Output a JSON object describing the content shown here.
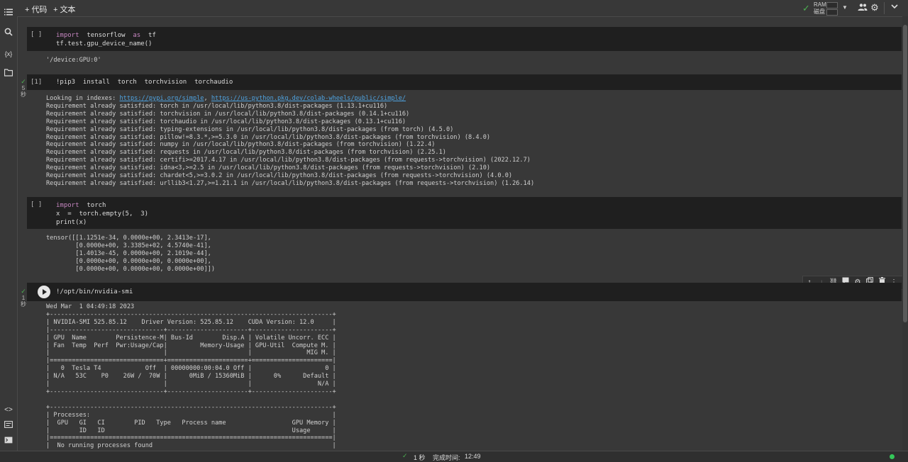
{
  "toolbar": {
    "add_code": "代码",
    "add_text": "文本",
    "ram_label": "RAM",
    "disk_label": "磁盘"
  },
  "cells": [
    {
      "exec_label": "[ ]",
      "code_lines": [
        {
          "kw1": "import",
          "t1": "  tensorflow  ",
          "kw2": "as",
          "t2": "  tf"
        },
        {
          "text": "tf.test.gpu_device_name()"
        }
      ],
      "output": "'/device:GPU:0'"
    },
    {
      "exec_label": "[1]",
      "status_time": "5",
      "status_unit": "秒",
      "code": "!pip3  install  torch  torchvision  torchaudio",
      "output_prefix": "Looking in indexes: ",
      "link1": "https://pypi.org/simple",
      "link_sep": ", ",
      "link2": "https://us-python.pkg.dev/colab-wheels/public/simple/",
      "output_lines": [
        "Requirement already satisfied: torch in /usr/local/lib/python3.8/dist-packages (1.13.1+cu116)",
        "Requirement already satisfied: torchvision in /usr/local/lib/python3.8/dist-packages (0.14.1+cu116)",
        "Requirement already satisfied: torchaudio in /usr/local/lib/python3.8/dist-packages (0.13.1+cu116)",
        "Requirement already satisfied: typing-extensions in /usr/local/lib/python3.8/dist-packages (from torch) (4.5.0)",
        "Requirement already satisfied: pillow!=8.3.*,>=5.3.0 in /usr/local/lib/python3.8/dist-packages (from torchvision) (8.4.0)",
        "Requirement already satisfied: numpy in /usr/local/lib/python3.8/dist-packages (from torchvision) (1.22.4)",
        "Requirement already satisfied: requests in /usr/local/lib/python3.8/dist-packages (from torchvision) (2.25.1)",
        "Requirement already satisfied: certifi>=2017.4.17 in /usr/local/lib/python3.8/dist-packages (from requests->torchvision) (2022.12.7)",
        "Requirement already satisfied: idna<3,>=2.5 in /usr/local/lib/python3.8/dist-packages (from requests->torchvision) (2.10)",
        "Requirement already satisfied: chardet<5,>=3.0.2 in /usr/local/lib/python3.8/dist-packages (from requests->torchvision) (4.0.0)",
        "Requirement already satisfied: urllib3<1.27,>=1.21.1 in /usr/local/lib/python3.8/dist-packages (from requests->torchvision) (1.26.14)"
      ]
    },
    {
      "exec_label": "[ ]",
      "code_lines": [
        {
          "kw1": "import",
          "t1": "  torch"
        },
        {
          "text": "x  =  torch.empty(5,  3)"
        },
        {
          "text": "print(x)"
        }
      ],
      "output_lines": [
        "tensor([[1.1251e-34, 0.0000e+00, 2.3413e-17],",
        "        [0.0000e+00, 3.3385e+02, 4.5740e-41],",
        "        [1.4013e-45, 0.0000e+00, 2.1019e-44],",
        "        [0.0000e+00, 0.0000e+00, 0.0000e+00],",
        "        [0.0000e+00, 0.0000e+00, 0.0000e+00]])"
      ]
    },
    {
      "status_time": "1",
      "status_unit": "秒",
      "code": "!/opt/bin/nvidia-smi",
      "output_lines": [
        "Wed Mar  1 04:49:18 2023",
        "+-----------------------------------------------------------------------------+",
        "| NVIDIA-SMI 525.85.12    Driver Version: 525.85.12    CUDA Version: 12.0     |",
        "|-------------------------------+----------------------+----------------------+",
        "| GPU  Name        Persistence-M| Bus-Id        Disp.A | Volatile Uncorr. ECC |",
        "| Fan  Temp  Perf  Pwr:Usage/Cap|         Memory-Usage | GPU-Util  Compute M. |",
        "|                               |                      |               MIG M. |",
        "|===============================+======================+======================|",
        "|   0  Tesla T4            Off  | 00000000:00:04.0 Off |                    0 |",
        "| N/A   53C    P0    26W /  70W |      0MiB / 15360MiB |      0%      Default |",
        "|                               |                      |                  N/A |",
        "+-------------------------------+----------------------+----------------------+",
        "",
        "+-----------------------------------------------------------------------------+",
        "| Processes:                                                                  |",
        "|  GPU   GI   CI        PID   Type   Process name                  GPU Memory |",
        "|        ID   ID                                                   Usage      |",
        "|=============================================================================|",
        "|  No running processes found                                                 |"
      ]
    }
  ],
  "statusbar": {
    "exec_time": "1 秒",
    "done_label": "完成时间:",
    "done_time": "12:49"
  }
}
